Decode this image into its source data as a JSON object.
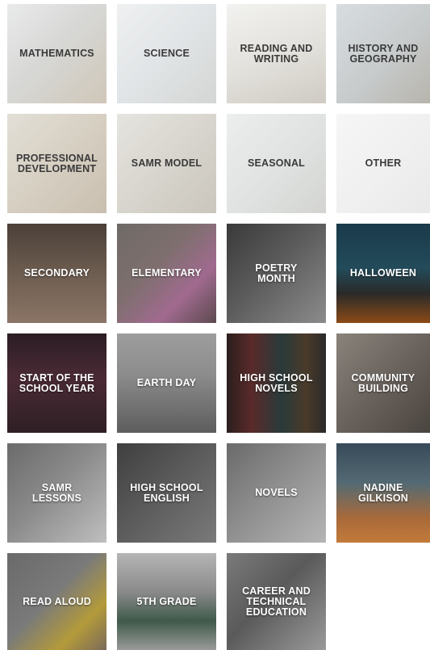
{
  "tiles": [
    {
      "label": "MATHEMATICS",
      "theme": "light",
      "bg": "linear-gradient(135deg,#e9eaea 0%,#d7d8d6 45%,#cfc6b8 100%)"
    },
    {
      "label": "SCIENCE",
      "theme": "light",
      "bg": "linear-gradient(135deg,#eef0f1 0%,#e1e4e6 50%,#d4d6d4 100%)"
    },
    {
      "label": "READING AND\nWRITING",
      "theme": "light",
      "bg": "linear-gradient(160deg,#f2f2f0 0%,#e2e0db 55%,#cfcbc3 100%)"
    },
    {
      "label": "HISTORY AND\nGEOGRAPHY",
      "theme": "light",
      "bg": "linear-gradient(135deg,#d8dde0 0%,#c7cbcc 55%,#b7b4ac 100%)"
    },
    {
      "label": "PROFESSIONAL\nDEVELOPMENT",
      "theme": "light",
      "bg": "linear-gradient(135deg,#e3dfd7 0%,#d6cfc2 50%,#c9bfaf 100%)"
    },
    {
      "label": "SAMR MODEL",
      "theme": "light",
      "bg": "linear-gradient(135deg,#e6e4df 0%,#d8d5ce 50%,#cac6bd 100%)"
    },
    {
      "label": "SEASONAL",
      "theme": "light",
      "bg": "linear-gradient(135deg,#eceeee 0%,#dfe2e1 55%,#d3d4d0 100%)"
    },
    {
      "label": "OTHER",
      "theme": "light",
      "bg": "linear-gradient(135deg,#f6f6f6 0%,#efefef 60%,#e9e9e9 100%)"
    },
    {
      "label": "SECONDARY",
      "theme": "dark",
      "bg": "linear-gradient(180deg,#4b4039 0%,#6a5a4e 45%,#8b7566 100%)"
    },
    {
      "label": "ELEMENTARY",
      "theme": "dark",
      "bg": "linear-gradient(135deg,#6f6a66 0%,#7e6f6e 40%,#a06a8f 70%,#5c4a4e 100%)"
    },
    {
      "label": "POETRY\nMONTH",
      "theme": "dark",
      "bg": "linear-gradient(135deg,#3a3a3a 0%,#5b5b5b 45%,#8b8b8b 100%)"
    },
    {
      "label": "HALLOWEEN",
      "theme": "dark",
      "bg": "linear-gradient(180deg,#1a3a4a 0%,#234b5a 45%,#2a2a2a 70%,#8b4a16 100%)"
    },
    {
      "label": "START OF THE\nSCHOOL YEAR",
      "theme": "dark",
      "bg": "linear-gradient(180deg,#2b1d24 0%,#4a2a35 45%,#2f1f25 100%)"
    },
    {
      "label": "EARTH DAY",
      "theme": "dark",
      "bg": "linear-gradient(180deg,#9d9d9d 0%,#8d8d8d 40%,#5d5d5d 100%)"
    },
    {
      "label": "HIGH SCHOOL\nNOVELS",
      "theme": "dark",
      "bg": "linear-gradient(90deg,#2a1f1d 0%,#5a2a2a 25%,#2a3a3a 55%,#4a3a2a 80%,#2a2a2a 100%)"
    },
    {
      "label": "COMMUNITY\nBUILDING",
      "theme": "dark",
      "bg": "linear-gradient(135deg,#8a837c 0%,#6a625c 50%,#4a4440 100%)"
    },
    {
      "label": "SAMR\nLESSONS",
      "theme": "dark",
      "bg": "linear-gradient(135deg,#6b6b6b 0%,#8a8a8a 45%,#bfbfbf 100%)"
    },
    {
      "label": "HIGH SCHOOL\nENGLISH",
      "theme": "dark",
      "bg": "linear-gradient(135deg,#3f3f3f 0%,#5a5a5a 45%,#7a7a7a 100%)"
    },
    {
      "label": "NOVELS",
      "theme": "dark",
      "bg": "linear-gradient(135deg,#6a6a6a 0%,#8d8d8d 45%,#b5b5b5 100%)"
    },
    {
      "label": "NADINE\nGILKISON",
      "theme": "dark",
      "bg": "linear-gradient(180deg,#384a5a 0%,#546a73 40%,#a86a3a 75%,#c27a3a 100%)"
    },
    {
      "label": "READ ALOUD",
      "theme": "dark",
      "bg": "linear-gradient(135deg,#6a6a6a 0%,#7a7a7a 45%,#b39a3a 75%,#7a6a5a 100%)"
    },
    {
      "label": "5TH GRADE",
      "theme": "dark",
      "bg": "linear-gradient(180deg,#b5b5b5 0%,#8a8a8a 40%,#3f5a4a 70%,#9a9a9a 100%)"
    },
    {
      "label": "CAREER AND\nTECHNICAL\nEDUCATION",
      "theme": "dark",
      "bg": "linear-gradient(135deg,#7a7a7a 0%,#5a5a5a 45%,#9a9a9a 100%)"
    }
  ]
}
